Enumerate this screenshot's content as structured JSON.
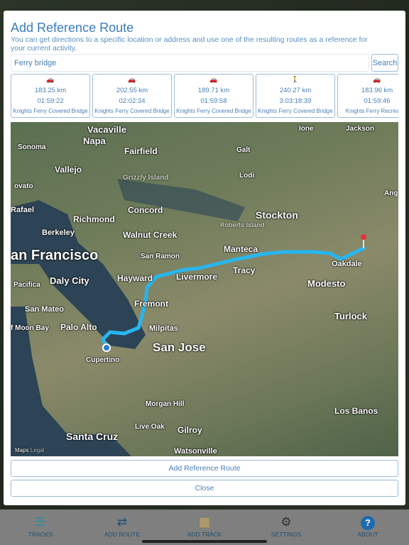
{
  "modal": {
    "title": "Add Reference Route",
    "description": "You can get directions to a specific location or address and use one of the resulting routes as a reference for your current activity.",
    "search_value": "Ferry bridge",
    "search_button": "Search",
    "routes": [
      {
        "icon": "car-icon",
        "distance": "183.25 km",
        "time": "01:59:22",
        "name": "Knights Ferry Covered Bridge"
      },
      {
        "icon": "car-icon",
        "distance": "202.55 km",
        "time": "02:02:34",
        "name": "Knights Ferry Covered Bridge"
      },
      {
        "icon": "car-icon",
        "distance": "189.71 km",
        "time": "01:59:58",
        "name": "Knights Ferry Covered Bridge"
      },
      {
        "icon": "walking-icon",
        "distance": "240.27 km",
        "time": "3.03:18:39",
        "name": "Knights Ferry Covered Bridge"
      },
      {
        "icon": "car-icon",
        "distance": "183.96 km",
        "time": "01:59:46",
        "name": "Knights Ferry Recreation"
      }
    ],
    "map": {
      "attribution": "Maps",
      "legal": "Legal",
      "route_color": "#27b6f0",
      "labels": [
        "Vacaville",
        "Napa",
        "Sonoma",
        "Fairfield",
        "Vallejo",
        "Grizzly Island",
        "Galt",
        "Lodi",
        "Ione",
        "Jackson",
        "Rafael",
        "Richmond",
        "Concord",
        "Berkeley",
        "Walnut Creek",
        "Stockton",
        "Roberts Island",
        "an Francisco",
        "San Ramon",
        "Manteca",
        "Oakdale",
        "Hayward",
        "Livermore",
        "Tracy",
        "Pacifica",
        "Daly City",
        "Modesto",
        "Fremont",
        "San Mateo",
        "Turlock",
        "f Moon Bay",
        "Palo Alto",
        "Milpitas",
        "San Jose",
        "Cupertino",
        "Morgan Hill",
        "Los Banos",
        "Santa Cruz",
        "Live Oak",
        "Gilroy",
        "Watsonville",
        "ovato",
        "Ang"
      ]
    },
    "add_button": "Add Reference Route",
    "close_button": "Close"
  },
  "tabbar": {
    "items": [
      {
        "label": "TRACKS",
        "icon": "list-icon"
      },
      {
        "label": "ADD ROUTE",
        "icon": "arrows-icon"
      },
      {
        "label": "ADD TRACK",
        "icon": "map-icon"
      },
      {
        "label": "SETTINGS",
        "icon": "gear-icon"
      },
      {
        "label": "ABOUT",
        "icon": "help-icon"
      }
    ]
  }
}
